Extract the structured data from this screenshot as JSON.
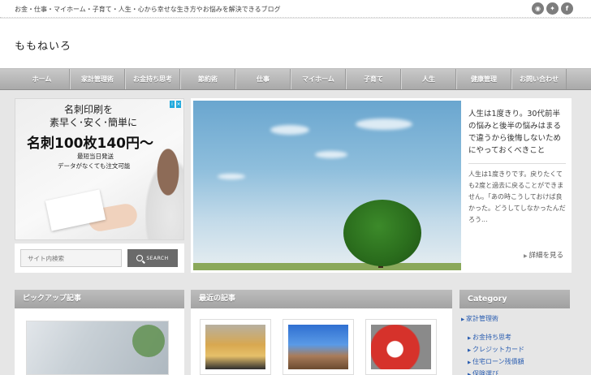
{
  "topbar": {
    "tagline": "お金・仕事・マイホーム・子育て・人生・心から幸せな生き方やお悩みを解決できるブログ",
    "social": [
      "rss-icon",
      "twitter-icon",
      "facebook-icon"
    ]
  },
  "site": {
    "title": "ももねいろ"
  },
  "nav": {
    "items": [
      "ホーム",
      "家計管理術",
      "お金持ち思考",
      "節約術",
      "仕事",
      "マイホーム",
      "子育て",
      "人生",
      "健康管理",
      "お問い合わせ"
    ]
  },
  "ad": {
    "line1": "名刺印刷を",
    "line2": "素早く･安く･簡単に",
    "line3": "名刺100枚140円〜",
    "line4": "最短当日発送",
    "line5": "データがなくても注文可能"
  },
  "search": {
    "placeholder": "サイト内検索",
    "button_label": "SEARCH"
  },
  "feature": {
    "title": "人生は1度きり。30代前半の悩みと後半の悩みはまるで違うから後悔しないためにやっておくべきこと",
    "excerpt": "人生は1度きりです。戻りたくても2度と過去に戻ることができません。「あの時こうしておけば良かった。どうしてしなかったんだろう...",
    "more_label": "詳細を見る"
  },
  "sections": {
    "pickup": "ピックアップ記事",
    "recent": "最近の記事",
    "category": "Category"
  },
  "categories": {
    "top": "家計管理術",
    "sub": [
      "お金持ち思考",
      "クレジットカード",
      "住宅ローン残債額",
      "保険選び"
    ]
  },
  "colors": {
    "nav": "#b3b3b3",
    "link": "#2a5db0",
    "panel_head": "#aaaaaa"
  }
}
